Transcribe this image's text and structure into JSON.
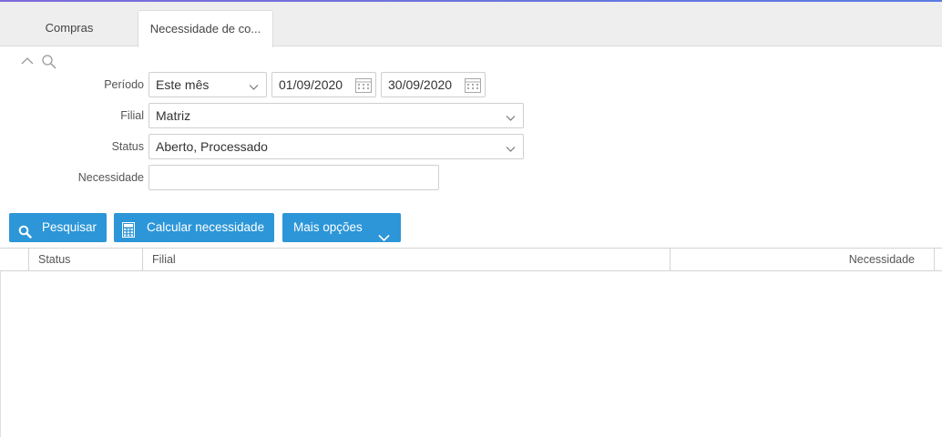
{
  "tabs": [
    {
      "label": "Compras"
    },
    {
      "label": "Necessidade de co..."
    }
  ],
  "filters": {
    "periodo": {
      "label": "Período",
      "value": "Este mês",
      "start": "01/09/2020",
      "end": "30/09/2020"
    },
    "filial": {
      "label": "Filial",
      "value": "Matriz"
    },
    "status": {
      "label": "Status",
      "value": "Aberto, Processado"
    },
    "necessidade": {
      "label": "Necessidade",
      "value": ""
    }
  },
  "buttons": {
    "pesquisar": "Pesquisar",
    "calcular": "Calcular necessidade",
    "mais_opcoes": "Mais opções"
  },
  "grid": {
    "columns": [
      "Status",
      "Filial",
      "Necessidade"
    ]
  },
  "colors": {
    "accent": "#2c96d8",
    "tab_bg": "#eeeeee"
  }
}
